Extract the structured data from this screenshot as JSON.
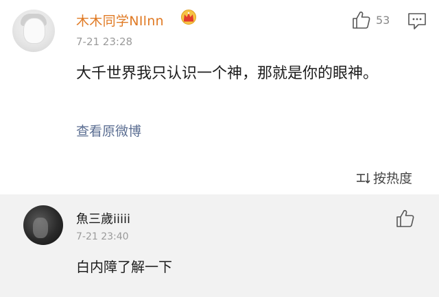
{
  "post": {
    "author": "木木同学NIlnn",
    "timestamp": "7-21 23:28",
    "like_count": "53",
    "content": "大千世界我只认识一个神，那就是你的眼神。",
    "view_original": "查看原微博",
    "sort_label": "按热度",
    "colors": {
      "author": "#e07a24",
      "link": "#5b6e92"
    }
  },
  "reply": {
    "author": "魚三歲iiiii",
    "timestamp": "7-21 23:40",
    "content": "白内障了解一下"
  },
  "icons": [
    "crown-icon",
    "thumbs-up-icon",
    "comment-icon",
    "sort-icon"
  ]
}
